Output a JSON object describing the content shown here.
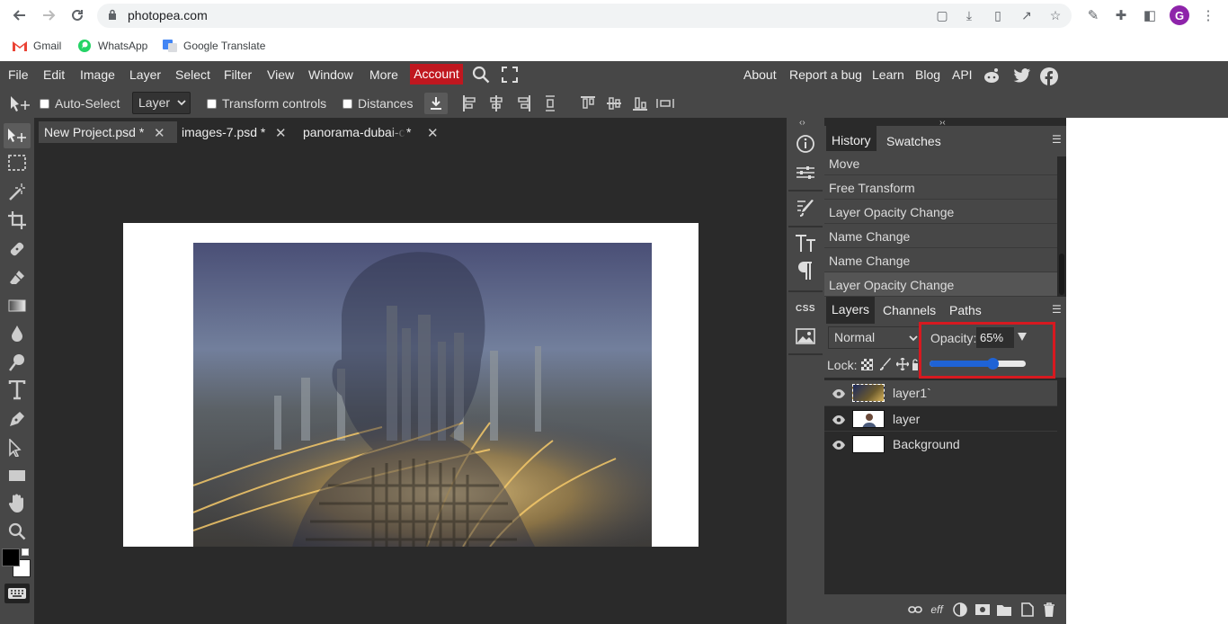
{
  "browser": {
    "url": "photopea.com",
    "avatar_letter": "G",
    "bookmarks": [
      "Gmail",
      "WhatsApp",
      "Google Translate"
    ]
  },
  "menubar": {
    "items": [
      "File",
      "Edit",
      "Image",
      "Layer",
      "Select",
      "Filter",
      "View",
      "Window",
      "More"
    ],
    "account": "Account",
    "right_items": [
      "About",
      "Report a bug",
      "Learn",
      "Blog",
      "API"
    ]
  },
  "options": {
    "auto_select": "Auto-Select",
    "layer_mode": "Layer",
    "transform_controls": "Transform controls",
    "distances": "Distances"
  },
  "documents": [
    {
      "name": "New Project.psd *",
      "active": true
    },
    {
      "name": "images-7.psd *",
      "active": false
    },
    {
      "name": "panorama-dubai-c",
      "suffix": "*",
      "active": false
    }
  ],
  "history_panel": {
    "tabs": [
      "History",
      "Swatches"
    ],
    "entries": [
      "Move",
      "Free Transform",
      "Layer Opacity Change",
      "Name Change",
      "Name Change",
      "Layer Opacity Change"
    ]
  },
  "layers_panel": {
    "tabs": [
      "Layers",
      "Channels",
      "Paths"
    ],
    "blend_mode": "Normal",
    "opacity_label": "Opacity:",
    "opacity_value": "65%",
    "opacity_slider_level": 0.65,
    "lock_label": "Lock:",
    "layers": [
      {
        "name": "layer1`",
        "selected": true
      },
      {
        "name": "layer",
        "selected": false
      },
      {
        "name": "Background",
        "selected": false
      }
    ]
  },
  "strip": {
    "css_label": "CSS"
  },
  "colors": {
    "accent_red": "#c0171f",
    "highlight_outline": "#d71920",
    "slider_blue": "#1f63d6"
  }
}
